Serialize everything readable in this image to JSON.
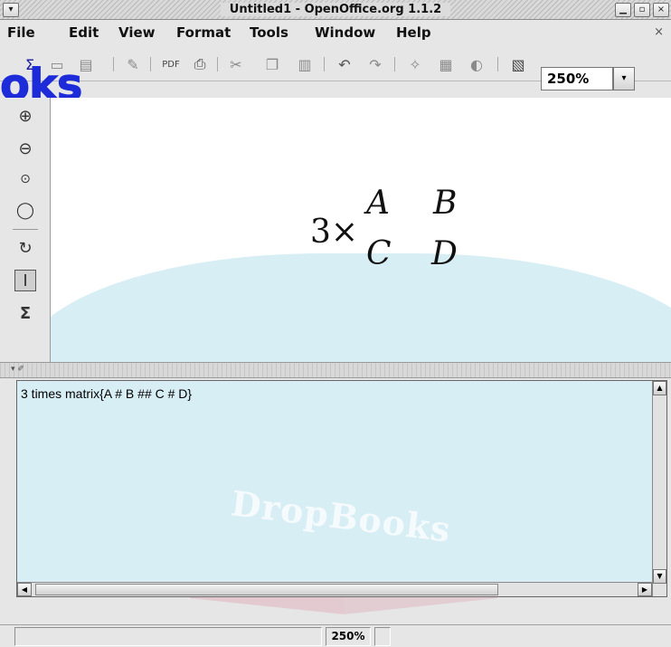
{
  "window": {
    "title": "Untitled1 - OpenOffice.org 1.1.2",
    "menu_icon": "chevron-down-icon",
    "controls": {
      "minimize": "minimize-icon",
      "maximize": "maximize-icon",
      "close": "close-icon"
    }
  },
  "menubar": {
    "items": [
      "File",
      "Edit",
      "View",
      "Format",
      "Tools",
      "Window",
      "Help"
    ],
    "doc_close": "×"
  },
  "toolbar": {
    "icons": [
      "summation-icon",
      "open-icon",
      "save-icon",
      "edit-icon",
      "export-pdf-icon",
      "print-icon",
      "cut-icon",
      "copy-icon",
      "paste-icon",
      "undo-icon",
      "redo-icon",
      "navigator-icon",
      "grid-icon",
      "gallery-icon",
      "image-icon"
    ],
    "zoom_value": "250%"
  },
  "overlay_brand": "oks",
  "left_tools": [
    "zoom-in-icon",
    "zoom-out-icon",
    "zoom-100-icon",
    "show-all-icon",
    "refresh-icon",
    "cursor-icon",
    "formula-icon"
  ],
  "formula_view": {
    "scalar": "3×",
    "matrix": [
      [
        "A",
        "B"
      ],
      [
        "C",
        "D"
      ]
    ]
  },
  "commands": {
    "text": "3 times matrix{A # B ## C # D}"
  },
  "watermark": "DropBooks",
  "statusbar": {
    "zoom": "250%"
  }
}
